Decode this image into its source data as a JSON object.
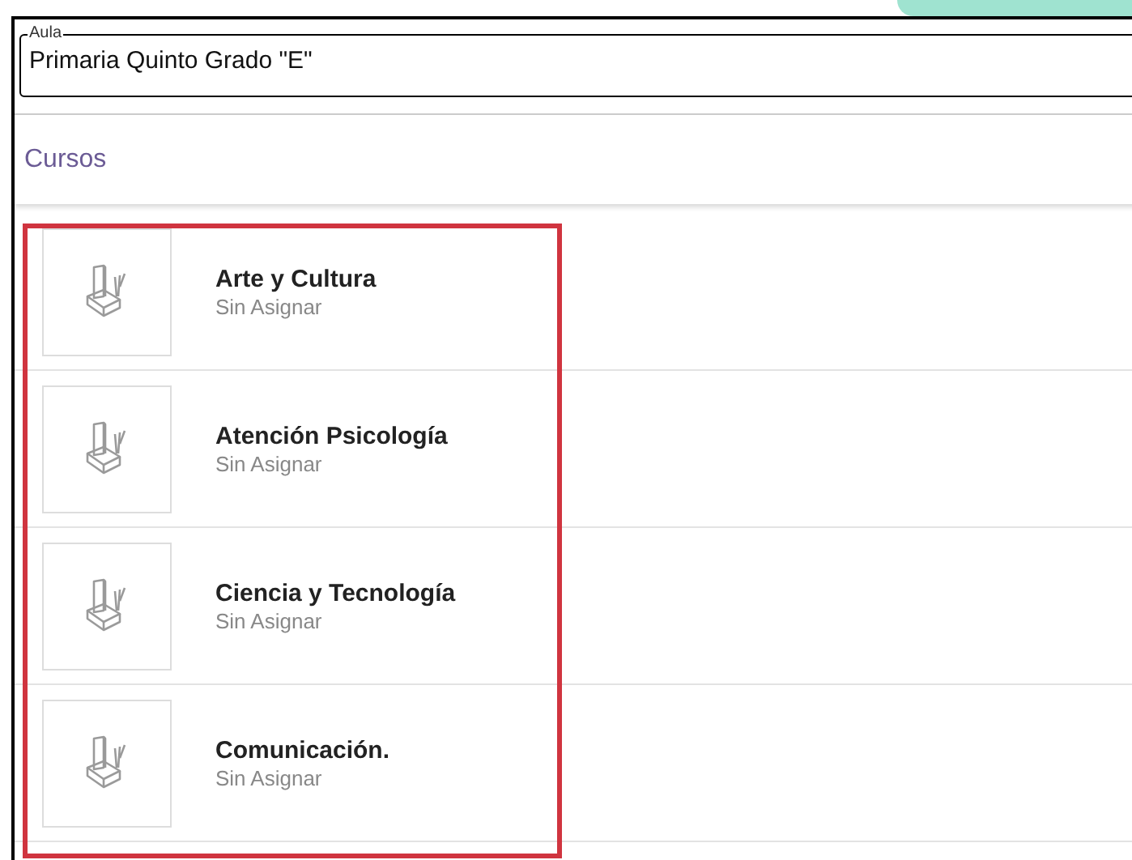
{
  "classroom_field": {
    "label": "Aula",
    "value": "Primaria Quinto Grado \"E\""
  },
  "section_title": "Cursos",
  "courses": [
    {
      "name": "Arte y Cultura",
      "teacher": "Sin Asignar"
    },
    {
      "name": "Atención Psicología",
      "teacher": "Sin Asignar"
    },
    {
      "name": "Ciencia y Tecnología",
      "teacher": "Sin Asignar"
    },
    {
      "name": "Comunicación.",
      "teacher": "Sin Asignar"
    }
  ]
}
